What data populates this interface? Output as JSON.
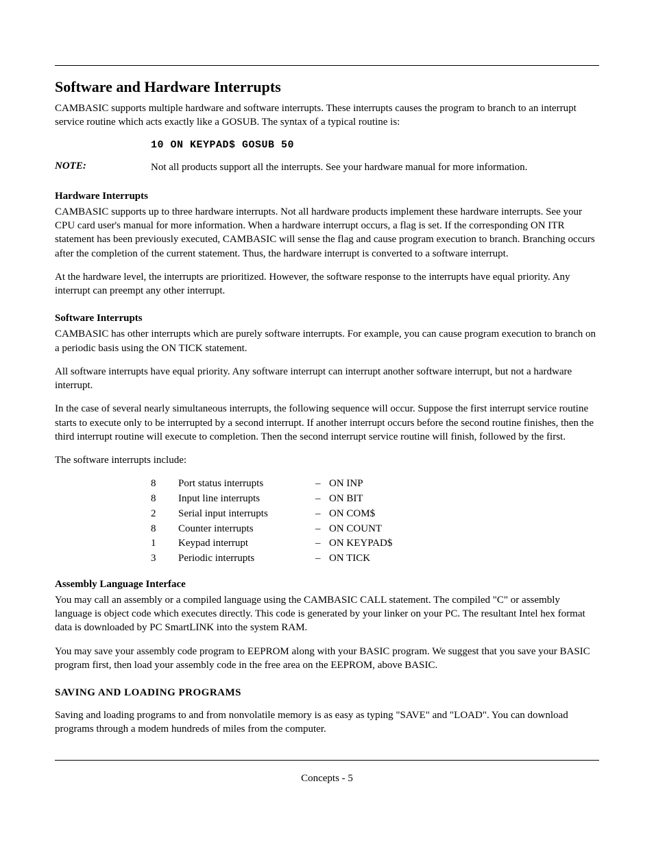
{
  "title": "Software and Hardware Interrupts",
  "intro": "CAMBASIC supports multiple hardware and software interrupts.  These interrupts causes the program to branch to an interrupt service routine which acts exactly like a GOSUB.  The syntax of a typical routine is:",
  "code_line": "10 ON KEYPAD$ GOSUB 50",
  "note_label": "NOTE:",
  "note_text": "Not all products support all the interrupts.  See your hardware manual for more information.",
  "hw_head": "Hardware Interrupts",
  "hw_p1": "CAMBASIC supports up to three hardware interrupts.  Not all hardware products implement these hardware interrupts. See your CPU card user's manual for more information.  When a hardware interrupt occurs, a flag is set.  If the corresponding ON ITR statement has been previously executed, CAMBASIC will sense the flag and cause program execution to branch.  Branching occurs after the completion of the current statement.  Thus, the hardware interrupt is converted to a software interrupt.",
  "hw_p2": "At the hardware level, the interrupts are prioritized.  However, the software response to the interrupts have equal priority. Any interrupt can preempt any other interrupt.",
  "sw_head": "Software Interrupts",
  "sw_p1": "CAMBASIC has other interrupts which are purely software interrupts.  For example, you can cause program execution to branch on a periodic basis using the ON TICK statement.",
  "sw_p2": "All software interrupts have equal priority.  Any software interrupt can interrupt another software interrupt, but not a hardware interrupt.",
  "sw_p3": "In the case of several nearly simultaneous interrupts, the following sequence will occur.  Suppose the first interrupt service routine starts to execute only to be interrupted by a second interrupt.  If another interrupt occurs before the second routine finishes, then the third interrupt routine will execute to completion.  Then the second interrupt service routine will finish, followed by the first.",
  "sw_p4": "The software interrupts include:",
  "interrupts": [
    {
      "count": "8",
      "desc": "Port status interrupts",
      "cmd": "ON INP"
    },
    {
      "count": "8",
      "desc": "Input line interrupts",
      "cmd": "ON BIT"
    },
    {
      "count": "2",
      "desc": "Serial input interrupts",
      "cmd": "ON COM$"
    },
    {
      "count": "8",
      "desc": "Counter interrupts",
      "cmd": "ON COUNT"
    },
    {
      "count": "1",
      "desc": "Keypad interrupt",
      "cmd": "ON KEYPAD$"
    },
    {
      "count": "3",
      "desc": "Periodic interrupts",
      "cmd": "ON TICK"
    }
  ],
  "asm_head": "Assembly Language Interface",
  "asm_p1": "You may call an assembly or a compiled language using the CAMBASIC CALL statement.  The compiled \"C\" or assembly language is object code which executes directly.  This code is generated by your linker on your PC.  The resultant Intel hex format data is downloaded by PC SmartLINK into the system RAM.",
  "asm_p2": "You may save your assembly code program to EEPROM along with your BASIC program.  We suggest that you save your BASIC program first, then load your assembly code in the free area on the EEPROM, above BASIC.",
  "save_head": "SAVING AND LOADING PROGRAMS",
  "save_p1": "Saving and loading programs to and from nonvolatile memory is as easy as typing \"SAVE\" and \"LOAD\".  You can download programs through a modem hundreds of miles from the computer.",
  "footer": "Concepts - 5"
}
